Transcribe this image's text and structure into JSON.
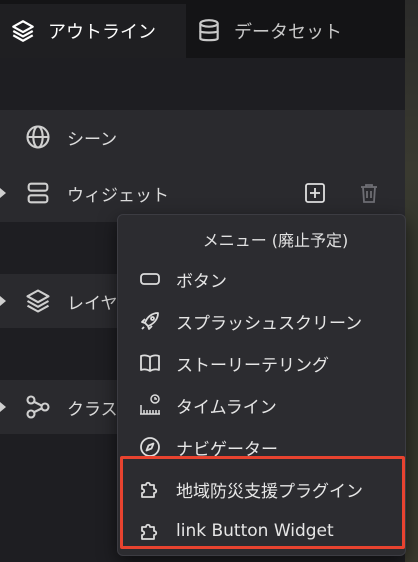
{
  "tabs": [
    {
      "label": "アウトライン",
      "icon": "layers-icon",
      "active": true
    },
    {
      "label": "データセット",
      "icon": "database-icon",
      "active": false
    }
  ],
  "outline_items": [
    {
      "label": "シーン",
      "icon": "globe-icon"
    },
    {
      "label": "ウィジェット",
      "icon": "widget-icon"
    },
    {
      "label": "レイヤー",
      "icon": "layers-icon"
    },
    {
      "label": "クラスタ",
      "icon": "cluster-icon"
    }
  ],
  "menu": {
    "header": "メニュー (廃止予定)",
    "items": [
      {
        "label": "ボタン",
        "icon": "button-icon"
      },
      {
        "label": "スプラッシュスクリーン",
        "icon": "rocket-icon"
      },
      {
        "label": "ストーリーテリング",
        "icon": "book-icon"
      },
      {
        "label": "タイムライン",
        "icon": "timeline-icon"
      },
      {
        "label": "ナビゲーター",
        "icon": "compass-icon"
      },
      {
        "label": "地域防災支援プラグイン",
        "icon": "puzzle-icon"
      },
      {
        "label": "link Button Widget",
        "icon": "puzzle-icon"
      }
    ]
  },
  "colors": {
    "highlight": "#e8432f",
    "menu_bg": "#2c2c30",
    "panel_bg": "#2a2a2e"
  }
}
